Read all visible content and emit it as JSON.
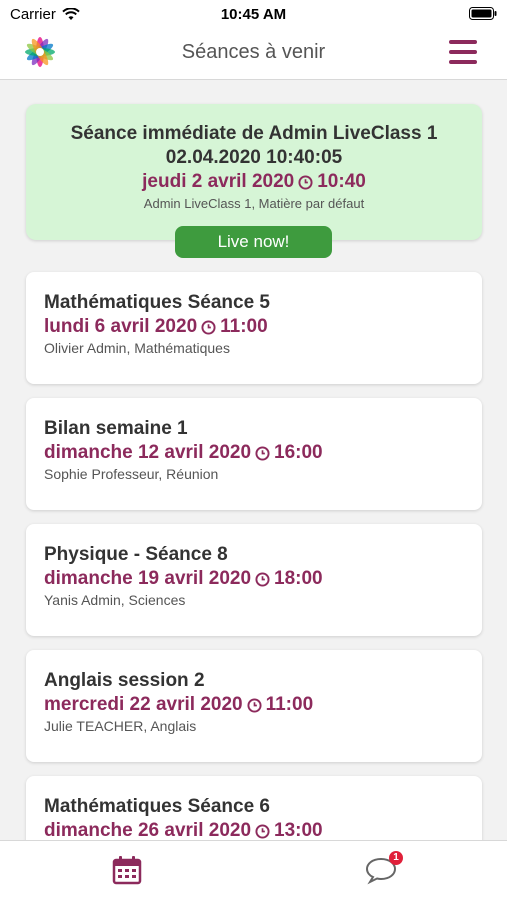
{
  "status_bar": {
    "carrier": "Carrier",
    "time": "10:45 AM"
  },
  "header": {
    "title": "Séances à venir",
    "logo_icon": "flower-logo-icon",
    "menu_icon": "hamburger-menu-icon"
  },
  "colors": {
    "accent": "#8c2a5c",
    "live_bg": "#d6f5d6",
    "live_button": "#3e9b3e",
    "badge": "#e0203a"
  },
  "live_session": {
    "title": "Séance immédiate de Admin LiveClass 1",
    "datetime": "02.04.2020 10:40:05",
    "day": "jeudi 2 avril 2020",
    "time": "10:40",
    "subtitle": "Admin LiveClass 1, Matière par défaut",
    "button_label": "Live now!"
  },
  "sessions": [
    {
      "title": "Mathématiques Séance 5",
      "day": "lundi 6 avril 2020",
      "time": "11:00",
      "subtitle": "Olivier Admin, Mathématiques"
    },
    {
      "title": "Bilan semaine 1",
      "day": "dimanche 12 avril 2020",
      "time": "16:00",
      "subtitle": "Sophie Professeur, Réunion"
    },
    {
      "title": "Physique - Séance 8",
      "day": "dimanche 19 avril 2020",
      "time": "18:00",
      "subtitle": "Yanis Admin, Sciences"
    },
    {
      "title": "Anglais session 2",
      "day": "mercredi 22 avril 2020",
      "time": "11:00",
      "subtitle": "Julie TEACHER, Anglais"
    },
    {
      "title": "Mathématiques Séance 6",
      "day": "dimanche 26 avril 2020",
      "time": "13:00",
      "subtitle": ""
    }
  ],
  "tab_bar": {
    "calendar_icon": "calendar-icon",
    "chat_icon": "chat-icon",
    "chat_badge": "1"
  }
}
